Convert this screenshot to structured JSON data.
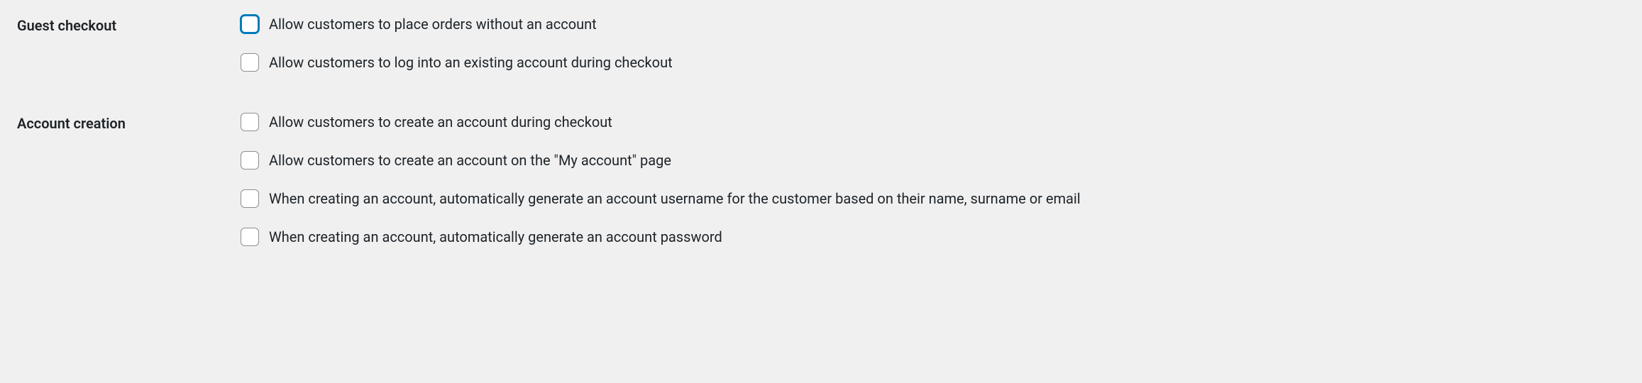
{
  "sections": {
    "guest_checkout": {
      "label": "Guest checkout",
      "options": {
        "allow_orders_without_account": "Allow customers to place orders without an account",
        "allow_login_during_checkout": "Allow customers to log into an existing account during checkout"
      }
    },
    "account_creation": {
      "label": "Account creation",
      "options": {
        "create_during_checkout": "Allow customers to create an account during checkout",
        "create_on_my_account": "Allow customers to create an account on the \"My account\" page",
        "auto_generate_username": "When creating an account, automatically generate an account username for the customer based on their name, surname or email",
        "auto_generate_password": "When creating an account, automatically generate an account password"
      }
    }
  }
}
